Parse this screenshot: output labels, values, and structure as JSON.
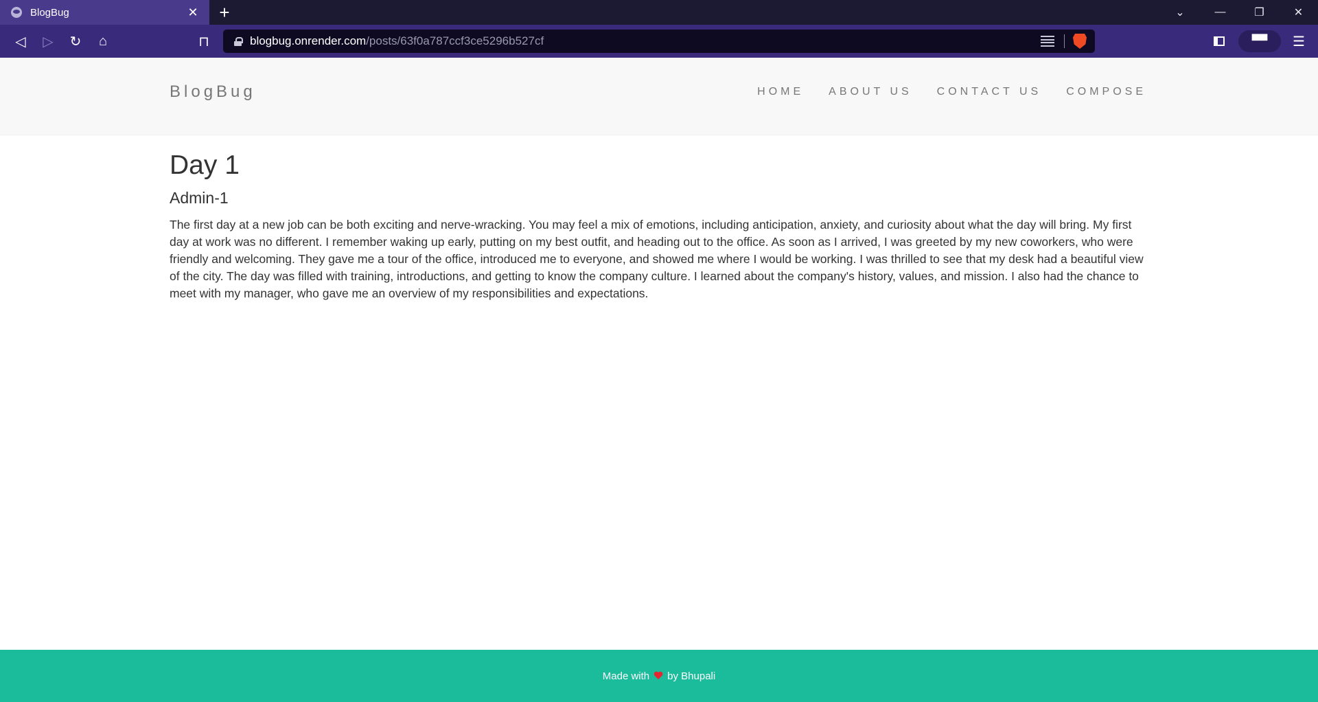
{
  "browser": {
    "tab": {
      "title": "BlogBug",
      "close_glyph": "✕",
      "favicon": "globe-icon"
    },
    "new_tab_glyph": "+",
    "window_controls": {
      "tab_search_glyph": "⌄",
      "minimize_glyph": "—",
      "restore_glyph": "❐",
      "close_glyph": "✕"
    },
    "toolbar": {
      "back_glyph": "◁",
      "forward_glyph": "▷",
      "reload_glyph": "↻",
      "home_glyph": "⌂",
      "bookmark_glyph": "⊓",
      "menu_glyph": "☰",
      "profile_glyph": "▀▀"
    },
    "address": {
      "host": "blogbug.onrender.com",
      "path": "/posts/63f0a787ccf3ce5296b527cf"
    }
  },
  "site": {
    "brand": "BlogBug",
    "nav": {
      "home": "HOME",
      "about": "ABOUT US",
      "contact": "CONTACT US",
      "compose": "COMPOSE"
    },
    "post": {
      "title": "Day 1",
      "author": "Admin-1",
      "body": "The first day at a new job can be both exciting and nerve-wracking. You may feel a mix of emotions, including anticipation, anxiety, and curiosity about what the day will bring. My first day at work was no different. I remember waking up early, putting on my best outfit, and heading out to the office. As soon as I arrived, I was greeted by my new coworkers, who were friendly and welcoming. They gave me a tour of the office, introduced me to everyone, and showed me where I would be working. I was thrilled to see that my desk had a beautiful view of the city. The day was filled with training, introductions, and getting to know the company culture. I learned about the company's history, values, and mission. I also had the chance to meet with my manager, who gave me an overview of my responsibilities and expectations."
    },
    "footer": {
      "made_with": "Made with",
      "by": "by Bhupali"
    }
  },
  "colors": {
    "tab_strip": "#1c1a33",
    "toolbar": "#3a2a7c",
    "footer": "#1abc9c",
    "heart": "#e3262f"
  }
}
